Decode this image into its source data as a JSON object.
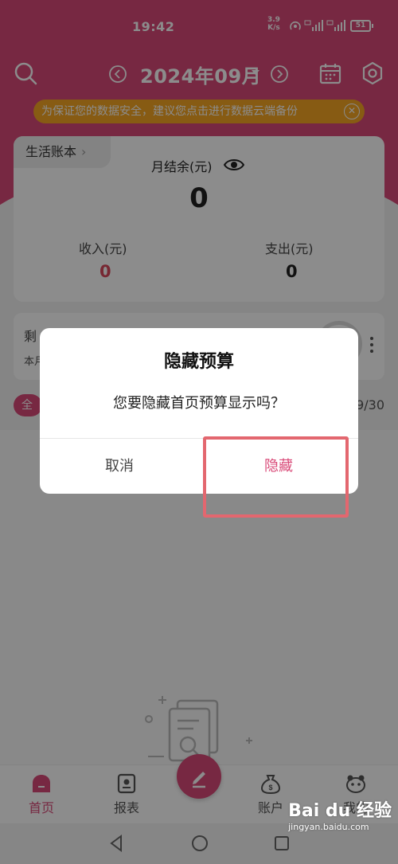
{
  "status_bar": {
    "time": "19:42",
    "net_speed_value": "3.9",
    "net_speed_unit": "K/s",
    "battery": "51"
  },
  "header": {
    "month_title": "2024年09月"
  },
  "notice": {
    "text": "为保证您的数据安全，建议您点击进行数据云端备份"
  },
  "summary": {
    "book_name": "生活账本",
    "balance_label": "月结余(元)",
    "balance_value": "0",
    "income_label": "收入(元)",
    "income_value": "0",
    "expense_label": "支出(元)",
    "expense_value": "0"
  },
  "budget": {
    "line1": "剩",
    "line2": "本月"
  },
  "filter": {
    "chip": "全",
    "day_count": "9/30"
  },
  "dialog": {
    "title": "隐藏预算",
    "message": "您要隐藏首页预算显示吗？",
    "cancel_label": "取消",
    "confirm_label": "隐藏"
  },
  "bottom_nav": {
    "home": "首页",
    "report": "报表",
    "account": "账户",
    "me": "我的"
  },
  "watermark": {
    "logo": "Bai du 经验",
    "url": "jingyan.baidu.com"
  },
  "colors": {
    "brand": "#d94a78",
    "notice": "#f6a623",
    "income": "#d94a5e",
    "highlight": "#e3676f"
  }
}
